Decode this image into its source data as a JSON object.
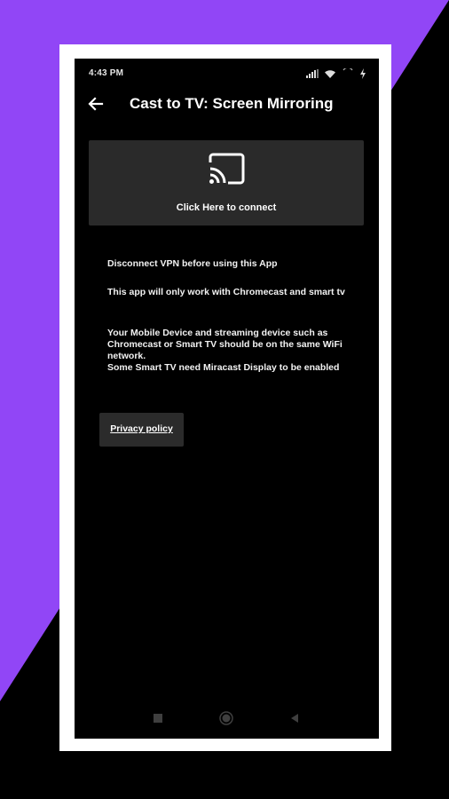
{
  "status_bar": {
    "time": "4:43 PM",
    "icons": [
      "signal-icon",
      "wifi-icon",
      "charging-icon"
    ]
  },
  "app_bar": {
    "back_icon": "arrow-left-icon",
    "title": "Cast to TV: Screen Mirroring"
  },
  "connect_card": {
    "icon": "cast-icon",
    "label": "Click Here to connect"
  },
  "info": {
    "line1": "Disconnect VPN before using this App",
    "line2": "This app will only work with Chromecast and smart tv",
    "line3": "Your Mobile Device and streaming device such as Chromecast or Smart TV should be on the same WiFi network.",
    "line4": "Some Smart TV need Miracast Display to be enabled"
  },
  "privacy": {
    "label": "Privacy policy"
  },
  "nav_bar": {
    "icons": [
      "recents-icon",
      "home-icon",
      "back-icon"
    ]
  },
  "colors": {
    "background_accent": "#9146f6",
    "screen_bg": "#000000",
    "card_bg": "#2a2a2a",
    "text": "#ffffff"
  }
}
